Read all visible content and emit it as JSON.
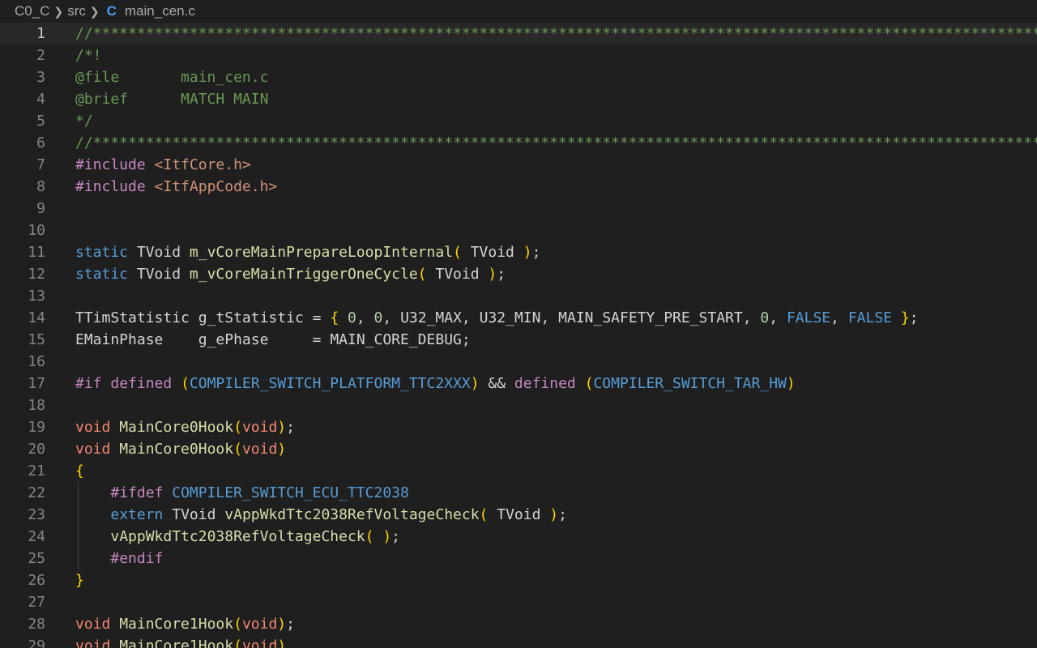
{
  "breadcrumb": {
    "folder1": "C0_C",
    "folder2": "src",
    "file_icon": "C",
    "file": "main_cen.c"
  },
  "lines": [
    {
      "n": "1",
      "text": "//*****************************************************************************************************************"
    },
    {
      "n": "2",
      "text": "/*!"
    },
    {
      "n": "3",
      "text": "@file       main_cen.c"
    },
    {
      "n": "4",
      "text": "@brief      MATCH MAIN"
    },
    {
      "n": "5",
      "text": "*/"
    },
    {
      "n": "6",
      "text": "//*****************************************************************************************************************"
    },
    {
      "n": "7",
      "text": "#include <ItfCore.h>"
    },
    {
      "n": "8",
      "text": "#include <ItfAppCode.h>"
    },
    {
      "n": "9",
      "text": ""
    },
    {
      "n": "10",
      "text": ""
    },
    {
      "n": "11",
      "text": "static TVoid m_vCoreMainPrepareLoopInternal( TVoid );"
    },
    {
      "n": "12",
      "text": "static TVoid m_vCoreMainTriggerOneCycle( TVoid );"
    },
    {
      "n": "13",
      "text": ""
    },
    {
      "n": "14",
      "text": "TTimStatistic g_tStatistic = { 0, 0, U32_MAX, U32_MIN, MAIN_SAFETY_PRE_START, 0, FALSE, FALSE };"
    },
    {
      "n": "15",
      "text": "EMainPhase    g_ePhase     = MAIN_CORE_DEBUG;"
    },
    {
      "n": "16",
      "text": ""
    },
    {
      "n": "17",
      "text": "#if defined (COMPILER_SWITCH_PLATFORM_TTC2XXX) && defined (COMPILER_SWITCH_TAR_HW)"
    },
    {
      "n": "18",
      "text": ""
    },
    {
      "n": "19",
      "text": "void MainCore0Hook(void);"
    },
    {
      "n": "20",
      "text": "void MainCore0Hook(void)"
    },
    {
      "n": "21",
      "text": "{"
    },
    {
      "n": "22",
      "text": "    #ifdef COMPILER_SWITCH_ECU_TTC2038"
    },
    {
      "n": "23",
      "text": "    extern TVoid vAppWkdTtc2038RefVoltageCheck( TVoid );"
    },
    {
      "n": "24",
      "text": "    vAppWkdTtc2038RefVoltageCheck( );"
    },
    {
      "n": "25",
      "text": "    #endif"
    },
    {
      "n": "26",
      "text": "}"
    },
    {
      "n": "27",
      "text": ""
    },
    {
      "n": "28",
      "text": "void MainCore1Hook(void);"
    },
    {
      "n": "29",
      "text": "void MainCore1Hook(void)"
    }
  ],
  "colors": {
    "background": "#1f1f1f",
    "comment": "#6a9955",
    "keyword": "#569cd6",
    "function": "#dcdcaa",
    "preprocessor": "#c586c0"
  }
}
